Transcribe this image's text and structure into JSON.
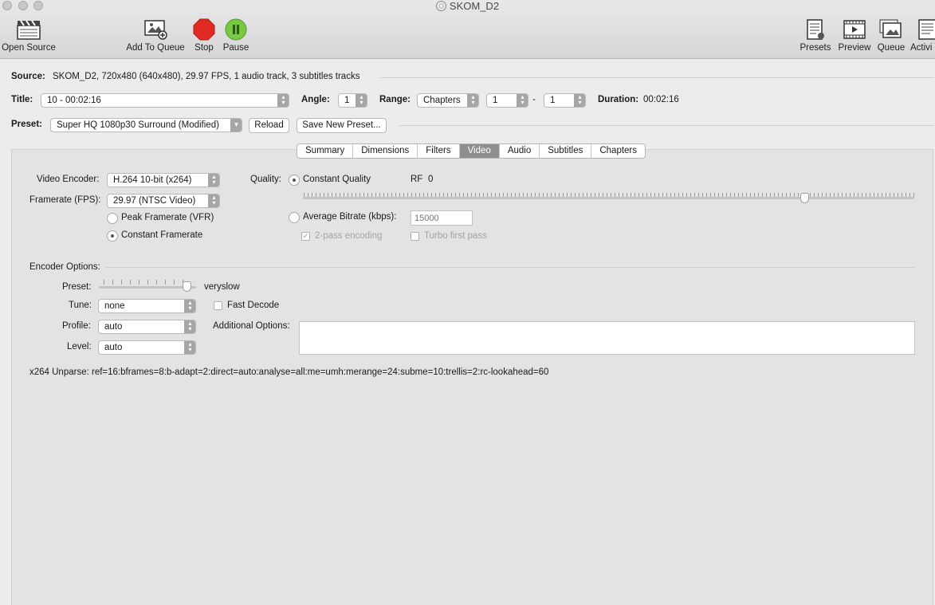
{
  "window": {
    "title": "SKOM_D2"
  },
  "toolbar": {
    "open_source": "Open Source",
    "add_to_queue": "Add To Queue",
    "stop": "Stop",
    "pause": "Pause",
    "presets": "Presets",
    "preview": "Preview",
    "queue": "Queue",
    "activity": "Activi"
  },
  "source": {
    "label": "Source:",
    "value": "SKOM_D2, 720x480 (640x480), 29.97 FPS, 1 audio track, 3 subtitles tracks"
  },
  "title_row": {
    "title_label": "Title:",
    "title_value": "10 - 00:02:16",
    "angle_label": "Angle:",
    "angle_value": "1",
    "range_label": "Range:",
    "range_type": "Chapters",
    "range_start": "1",
    "range_dash": "-",
    "range_end": "1",
    "duration_label": "Duration:",
    "duration_value": "00:02:16"
  },
  "preset_row": {
    "label": "Preset:",
    "value": "Super HQ 1080p30 Surround (Modified)",
    "reload": "Reload",
    "save_new": "Save New Preset..."
  },
  "tabs": [
    "Summary",
    "Dimensions",
    "Filters",
    "Video",
    "Audio",
    "Subtitles",
    "Chapters"
  ],
  "active_tab": "Video",
  "video": {
    "encoder_label": "Video Encoder:",
    "encoder_value": "H.264 10-bit (x264)",
    "framerate_label": "Framerate (FPS):",
    "framerate_value": "29.97 (NTSC Video)",
    "peak_framerate": "Peak Framerate (VFR)",
    "constant_framerate": "Constant Framerate",
    "quality_label": "Quality:",
    "constant_quality": "Constant Quality",
    "rf_label": "RF",
    "rf_value": "0",
    "quality_slider_level": 0.82,
    "average_bitrate": "Average Bitrate (kbps):",
    "bitrate_placeholder": "15000",
    "two_pass": "2-pass encoding",
    "turbo": "Turbo first pass"
  },
  "encoder_options": {
    "heading": "Encoder Options:",
    "preset_label": "Preset:",
    "preset_value": "veryslow",
    "preset_slider_level": 0.9,
    "tune_label": "Tune:",
    "tune_value": "none",
    "fast_decode": "Fast Decode",
    "profile_label": "Profile:",
    "profile_value": "auto",
    "additional_label": "Additional Options:",
    "level_label": "Level:",
    "level_value": "auto",
    "unparse": "x264 Unparse: ref=16:bframes=8:b-adapt=2:direct=auto:analyse=all:me=umh:merange=24:subme=10:trellis=2:rc-lookahead=60"
  }
}
